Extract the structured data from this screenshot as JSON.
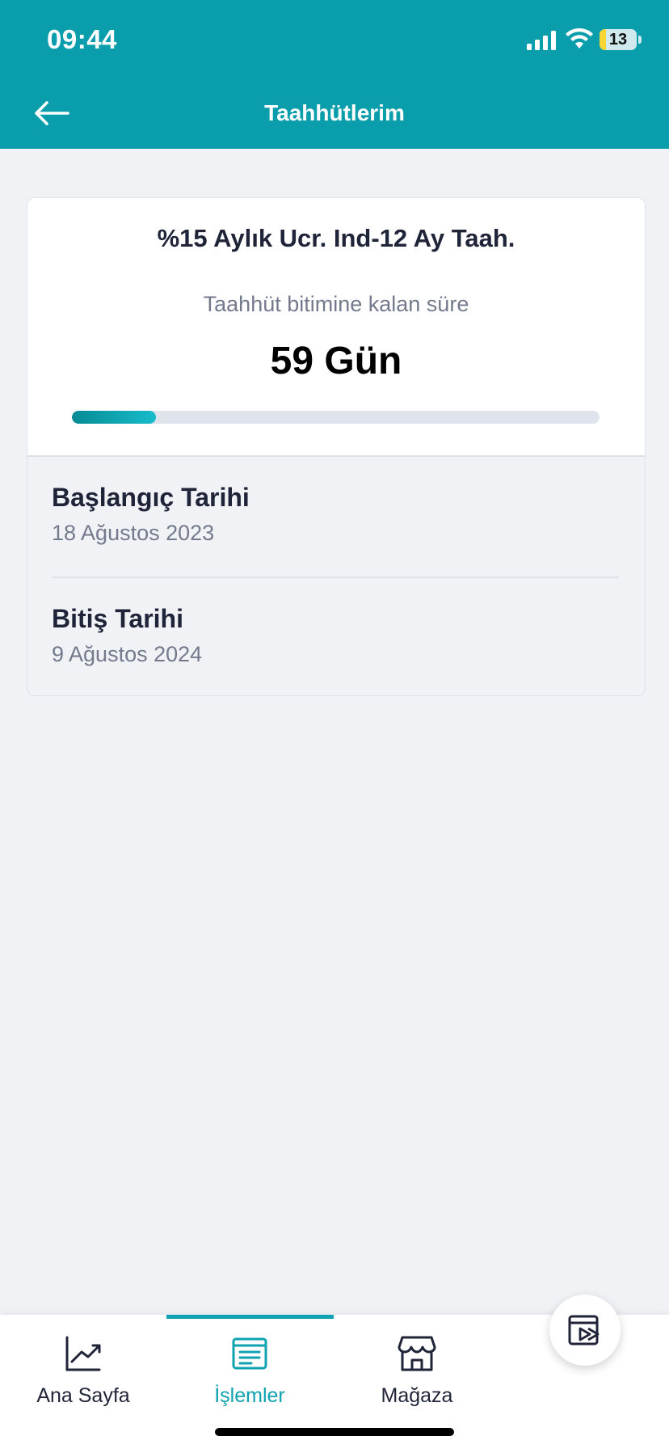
{
  "status_bar": {
    "time": "09:44",
    "battery_level": "13",
    "icons": [
      "signal-icon",
      "wifi-icon",
      "battery-icon"
    ]
  },
  "header": {
    "title": "Taahhütlerim",
    "back_icon": "arrow-left-icon"
  },
  "commitment": {
    "plan_name": "%15 Aylık Ucr. Ind-12 Ay Taah.",
    "remaining_label": "Taahhüt bitimine kalan süre",
    "remaining_value": "59 Gün",
    "progress_fraction": 0.16,
    "start_label": "Başlangıç Tarihi",
    "start_date": "18 Ağustos 2023",
    "end_label": "Bitiş Tarihi",
    "end_date": "9 Ağustos 2024"
  },
  "tab_bar": {
    "active_index": 1,
    "tabs": [
      {
        "label": "Ana Sayfa",
        "icon": "chart-line-icon"
      },
      {
        "label": "İşlemler",
        "icon": "document-list-icon"
      },
      {
        "label": "Mağaza",
        "icon": "store-icon"
      }
    ],
    "media_button_icon": "video-play-icon"
  },
  "colors": {
    "brand": "#0a9eac",
    "accent": "#0fa2b0",
    "background": "#f0f2f6",
    "text_primary": "#1f2438",
    "text_secondary": "#737a8c"
  }
}
